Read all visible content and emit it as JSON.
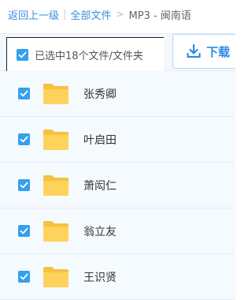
{
  "breadcrumb": {
    "back": "返回上一级",
    "separator": "|",
    "all_files": "全部文件",
    "arrow": ">",
    "current": "MP3 - 闽南语"
  },
  "toolbar": {
    "selection_text": "已选中18个文件/文件夹",
    "download_label": "下载"
  },
  "files": [
    {
      "name": "张秀卿",
      "type": "folder",
      "checked": true
    },
    {
      "name": "叶启田",
      "type": "folder",
      "checked": true
    },
    {
      "name": "萧闳仁",
      "type": "folder",
      "checked": true
    },
    {
      "name": "翁立友",
      "type": "folder",
      "checked": true
    },
    {
      "name": "王识贤",
      "type": "folder",
      "checked": true
    }
  ],
  "colors": {
    "accent": "#2f8be6",
    "checkbox": "#35a0ec",
    "folder": "#ffd25c",
    "row_bg": "#f5faff"
  },
  "icons": {
    "checkbox": "checkmark-icon",
    "download": "download-icon",
    "folder": "folder-icon"
  }
}
